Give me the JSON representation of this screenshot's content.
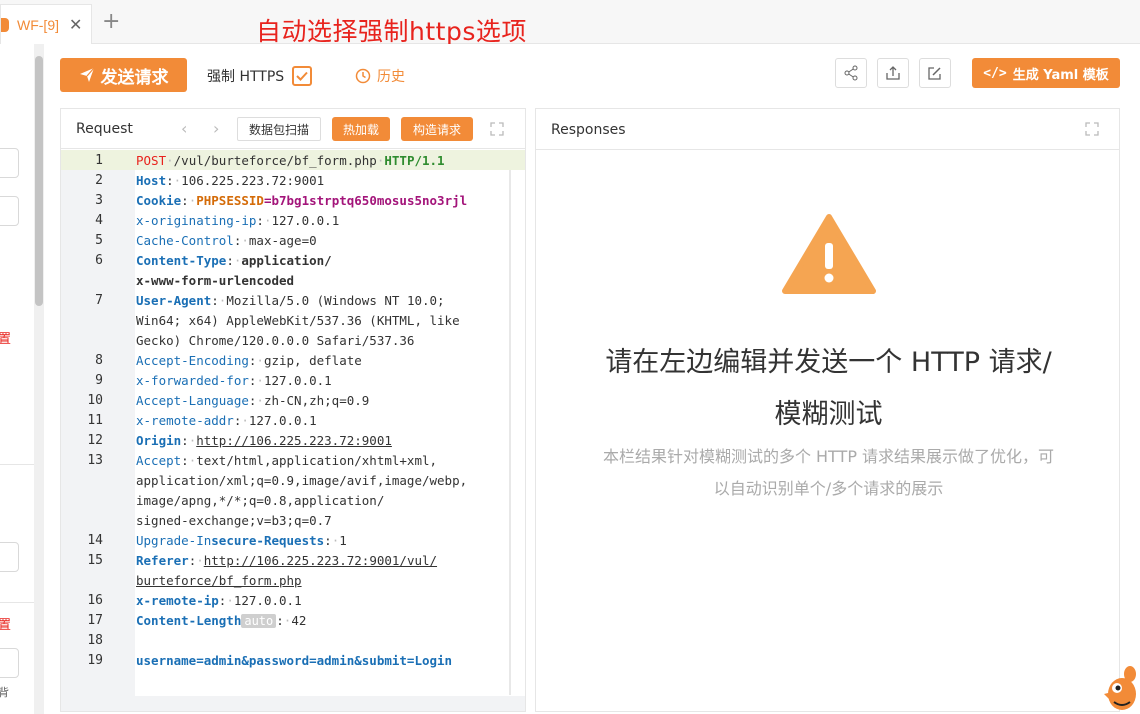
{
  "tabs": [
    {
      "label": "WF-[9]"
    }
  ],
  "annotation": "自动选择强制https选项",
  "left_pane": {
    "labels": [
      "置",
      "置"
    ],
    "small": "背"
  },
  "toolbar": {
    "send_label": "发送请求",
    "force_https_label": "强制 HTTPS",
    "force_https_checked": true,
    "history_label": "历史",
    "yaml_label": "生成 Yaml 模板",
    "icons": [
      "share-icon",
      "export-icon",
      "edit-icon"
    ]
  },
  "request": {
    "title": "Request",
    "scan_label": "数据包扫描",
    "hotload_label": "热加载",
    "build_label": "构造请求",
    "line_numbers": [
      "1",
      "2",
      "3",
      "4",
      "5",
      "6",
      "7",
      "8",
      "9",
      "10",
      "11",
      "12",
      "13",
      "14",
      "15",
      "16",
      "17",
      "18",
      "19"
    ],
    "lines": [
      {
        "method": "POST",
        "path": "/vul/burteforce/bf_form.php",
        "proto": "HTTP/1.1"
      },
      {
        "key": "Host",
        "value": "106.225.223.72:9001"
      },
      {
        "key": "Cookie",
        "cookie_name": "PHPSESSID",
        "cookie_value": "b7bg1strptq650mosus5no3rjl"
      },
      {
        "key": "x-originating-ip",
        "value": "127.0.0.1"
      },
      {
        "key": "Cache-Control",
        "value": "max-age=0"
      },
      {
        "key": "Content-Type",
        "value": "application/",
        "cont": "x-www-form-urlencoded"
      },
      {
        "key": "User-Agent",
        "value": "Mozilla/5.0 (Windows NT 10.0;",
        "cont": "Win64; x64) AppleWebKit/537.36 (KHTML, like",
        "cont2": "Gecko) Chrome/120.0.0.0 Safari/537.36"
      },
      {
        "key": "Accept-Encoding",
        "value": "gzip, deflate"
      },
      {
        "key": "x-forwarded-for",
        "value": "127.0.0.1"
      },
      {
        "key": "Accept-Language",
        "value": "zh-CN,zh;q=0.9"
      },
      {
        "key": "x-remote-addr",
        "value": "127.0.0.1"
      },
      {
        "key": "Origin",
        "value": "http://106.225.223.72:9001"
      },
      {
        "key": "Accept",
        "value": "text/html,application/xhtml+xml,",
        "cont": "application/xml;q=0.9,image/avif,image/webp,",
        "cont2": "image/apng,*/*;q=0.8,application/",
        "cont3": "signed-exchange;v=b3;q=0.7"
      },
      {
        "key_a": "Upgrade-In",
        "key_b": "secure-Requests",
        "value": "1"
      },
      {
        "key": "Referer",
        "value": "http://106.225.223.72:9001/vul/",
        "cont": "burteforce/bf_form.php"
      },
      {
        "key": "x-remote-ip",
        "value": "127.0.0.1"
      },
      {
        "key": "Content-Length",
        "tag": "auto",
        "value": "42"
      },
      {
        "blank": ""
      },
      {
        "body": "username=admin&password=admin&submit=Login"
      }
    ]
  },
  "response": {
    "title": "Responses",
    "empty_title_1": "请在左边编辑并发送一个 HTTP 请求/",
    "empty_title_2": "模糊测试",
    "empty_desc_1": "本栏结果针对模糊测试的多个 HTTP 请求结果展示做了优化，可",
    "empty_desc_2": "以自动识别单个/多个请求的展示"
  },
  "colors": {
    "accent": "#f28b38",
    "annotation": "#e8231d",
    "keyword": "#1a6fb5"
  }
}
